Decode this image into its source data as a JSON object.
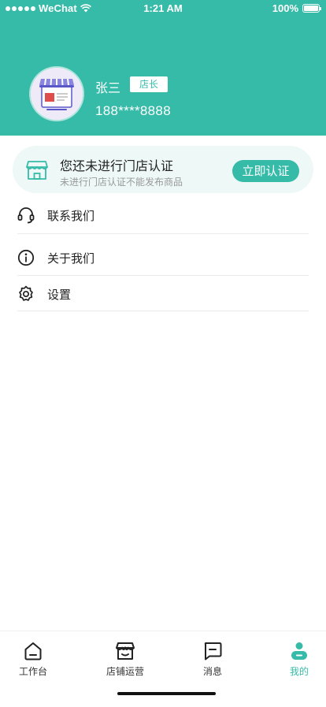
{
  "status_bar": {
    "carrier": "WeChat",
    "time": "1:21 AM",
    "battery": "100%"
  },
  "profile": {
    "name": "张三",
    "role_badge": "店长",
    "phone": "188****8888"
  },
  "certification": {
    "title": "您还未进行门店认证",
    "subtitle": "未进行门店认证不能发布商品",
    "button_label": "立即认证"
  },
  "menu": {
    "contact": "联系我们",
    "about": "关于我们",
    "settings": "设置"
  },
  "tabs": [
    {
      "label": "工作台",
      "icon": "home-icon"
    },
    {
      "label": "店铺运营",
      "icon": "store-icon"
    },
    {
      "label": "消息",
      "icon": "message-icon"
    },
    {
      "label": "我的",
      "icon": "user-icon",
      "active": true
    }
  ],
  "colors": {
    "primary": "#36bba8",
    "card_bg": "#eef8f6"
  }
}
